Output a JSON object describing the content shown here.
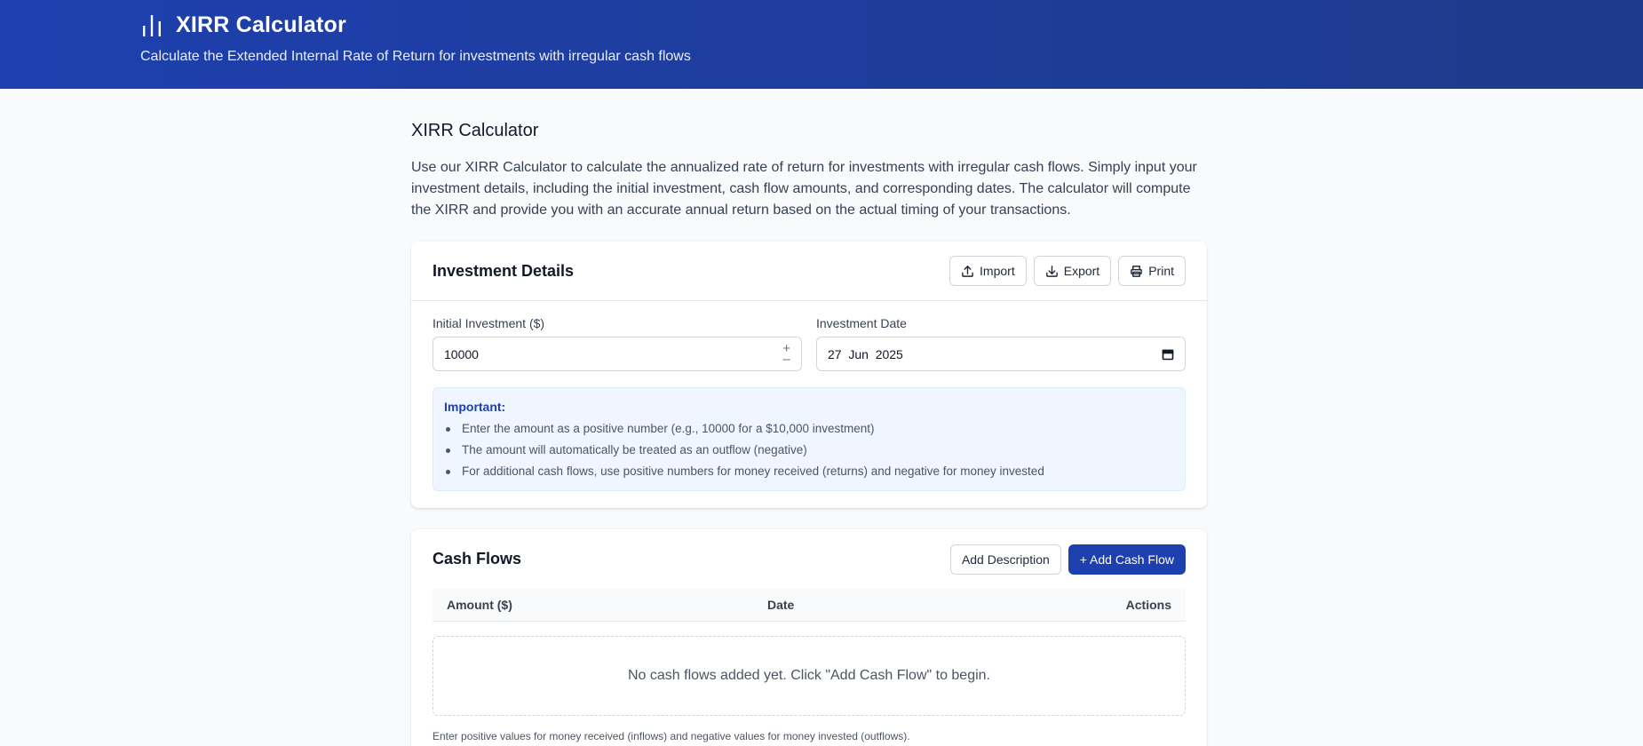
{
  "header": {
    "title": "XIRR Calculator",
    "subtitle": "Calculate the Extended Internal Rate of Return for investments with irregular cash flows",
    "icon": "bar-chart-icon"
  },
  "main": {
    "title": "XIRR Calculator",
    "intro": "Use our XIRR Calculator to calculate the annualized rate of return for investments with irregular cash flows. Simply input your investment details, including the initial investment, cash flow amounts, and corresponding dates. The calculator will compute the XIRR and provide you with an accurate annual return based on the actual timing of your transactions."
  },
  "details": {
    "title": "Investment Details",
    "import_label": "Import",
    "export_label": "Export",
    "print_label": "Print",
    "initial_label": "Initial Investment ($)",
    "initial_value": "10000",
    "date_label": "Investment Date",
    "date_value": "27  Jun  2025",
    "notice": {
      "title": "Important:",
      "items": [
        "Enter the amount as a positive number (e.g., 10000 for a $10,000 investment)",
        "The amount will automatically be treated as an outflow (negative)",
        "For additional cash flows, use positive numbers for money received (returns) and negative for money invested"
      ]
    }
  },
  "flows": {
    "title": "Cash Flows",
    "add_description_label": "Add Description",
    "add_cash_flow_label": "+ Add Cash Flow",
    "columns": [
      "Amount ($)",
      "Date",
      "Actions"
    ],
    "empty_message": "No cash flows added yet. Click \"Add Cash Flow\" to begin.",
    "note": "Enter positive values for money received (inflows) and negative values for money invested (outflows)."
  },
  "colors": {
    "header_bg": "#1e40af",
    "accent": "#1e40af",
    "notice_bg": "#eff6ff"
  }
}
